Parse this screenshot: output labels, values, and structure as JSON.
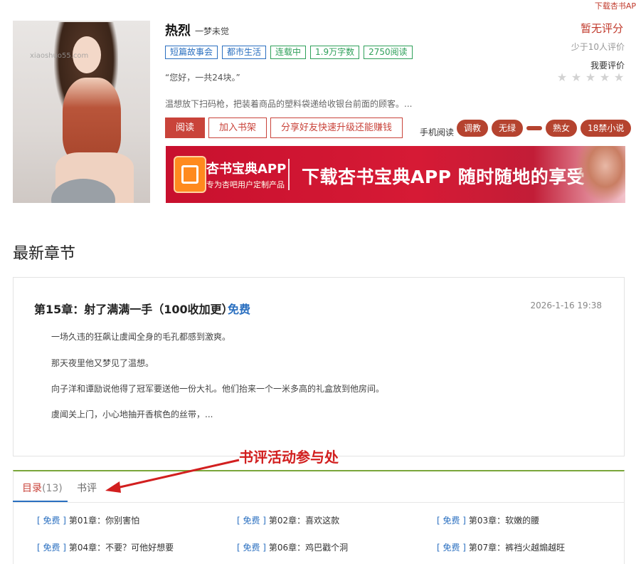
{
  "header": {
    "download_link": "下载杏书AP"
  },
  "book": {
    "title": "热烈",
    "author": "一梦未觉",
    "tags": [
      {
        "label": "短篇故事会",
        "color": "blue"
      },
      {
        "label": "都市生活",
        "color": "blue"
      },
      {
        "label": "连载中",
        "color": "green"
      },
      {
        "label": "1.9万字数",
        "color": "green"
      },
      {
        "label": "2750阅读",
        "color": "green"
      }
    ],
    "quote": "“您好，一共24块。”",
    "intro": "温想放下扫码枪，把装着商品的塑料袋递给收银台前面的顾客。...",
    "cover_watermark": "xiaoshuo55.com"
  },
  "rating": {
    "score_text": "暂无评分",
    "count_text": "少于10人评价",
    "rate_label": "我要评价",
    "stars": 5
  },
  "actions": {
    "read": "阅读",
    "add_shelf": "加入书架",
    "share": "分享好友快速升级还能赚钱",
    "mobile_read": "手机阅读"
  },
  "pills": [
    "调教",
    "无绿",
    "",
    "熟女",
    "18禁小说"
  ],
  "banner": {
    "app_name": "杏书宝典APP",
    "app_sub": "专为杏吧用户定制产品",
    "headline": "下载杏书宝典APP 随时随地的享受"
  },
  "latest": {
    "section_title": "最新章节",
    "chapter_title": "第15章：射了满满一手（100收加更）",
    "chapter_free": "免费",
    "date": "2026-1-16 19:38",
    "paragraphs": [
      "一场久违的狂飙让虞闻全身的毛孔都感到激爽。",
      "那天夜里他又梦见了温想。",
      "向子洋和谭励说他得了冠军要送他一份大礼。他们抬来一个一米多高的礼盒放到他房间。",
      "虞闻关上门，小心地抽开香槟色的丝带，..."
    ]
  },
  "annotation": "书评活动参与处",
  "tabs": {
    "toc_label": "目录",
    "toc_count": "(13)",
    "review_label": "书评"
  },
  "toc": [
    {
      "free": "[ 免费 ]",
      "title": "第01章：你别害怕"
    },
    {
      "free": "[ 免费 ]",
      "title": "第02章：喜欢这款"
    },
    {
      "free": "[ 免费 ]",
      "title": "第03章：软嫩的腰"
    },
    {
      "free": "[ 免费 ]",
      "title": "第04章：不要？可他好想要"
    },
    {
      "free": "[ 免费 ]",
      "title": "第06章：鸡巴戳个洞"
    },
    {
      "free": "[ 免费 ]",
      "title": "第07章：裤裆火越煽越旺"
    }
  ]
}
